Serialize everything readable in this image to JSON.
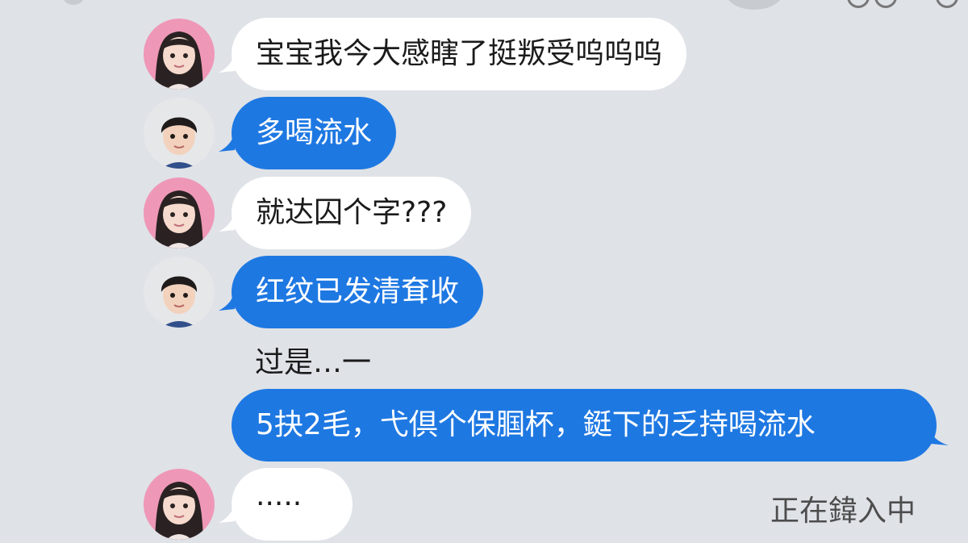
{
  "colors": {
    "background": "#dfe2e7",
    "incoming_bubble": "#ffffff",
    "outgoing_bubble": "#1e78e2"
  },
  "messages": [
    {
      "sender": "girl",
      "text": "宝宝我今大感瞎了挺叛受呜呜呜"
    },
    {
      "sender": "boy",
      "text": "多喝流水"
    },
    {
      "sender": "girl",
      "text": "就达囚个字???"
    },
    {
      "sender": "boy",
      "text": "红纹已发清耷收"
    },
    {
      "sender": "boy",
      "text": "过是…一"
    },
    {
      "sender": "boy",
      "text": "5抉2毛，弋倶个保腘杯，鋌下的乏持喝流水"
    },
    {
      "sender": "girl",
      "text": "·····"
    }
  ],
  "status": {
    "typing": "正在鍏入中"
  },
  "icons": {
    "girl_avatar": "girl-avatar-icon",
    "boy_avatar": "boy-avatar-icon"
  }
}
